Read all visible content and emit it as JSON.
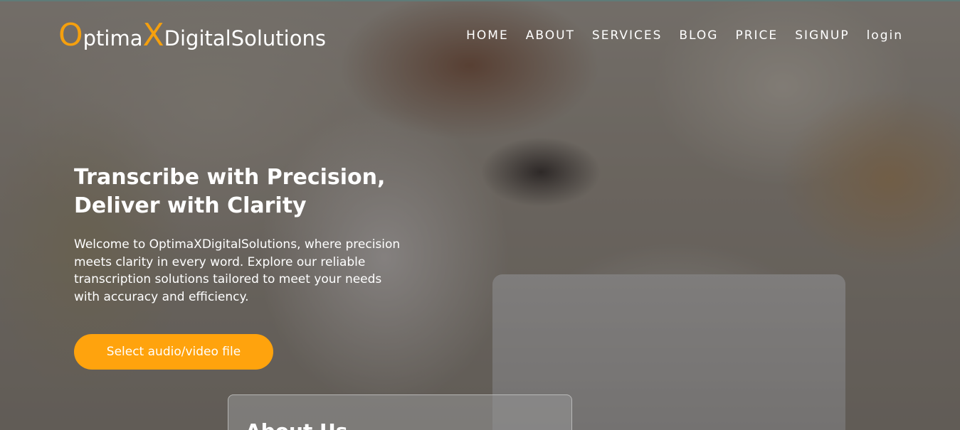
{
  "logo": {
    "o": "O",
    "ptima": "ptima",
    "x": "X",
    "rest": "DigitalSolutions"
  },
  "nav": {
    "items": [
      {
        "label": "HOME"
      },
      {
        "label": "ABOUT"
      },
      {
        "label": "SERVICES"
      },
      {
        "label": "BLOG"
      },
      {
        "label": "PRICE"
      },
      {
        "label": "SIGNUP"
      },
      {
        "label": "login"
      }
    ]
  },
  "hero": {
    "title_line1": "Transcribe with Precision,",
    "title_line2": "Deliver with Clarity",
    "description": "Welcome to OptimaXDigitalSolutions, where precision meets clarity in every word. Explore our reliable transcription solutions tailored to meet your needs with accuracy and efficiency.",
    "cta_label": "Select audio/video file"
  },
  "about": {
    "heading": "About Us"
  },
  "colors": {
    "accent": "#ffa30d",
    "text": "#ffffff"
  }
}
